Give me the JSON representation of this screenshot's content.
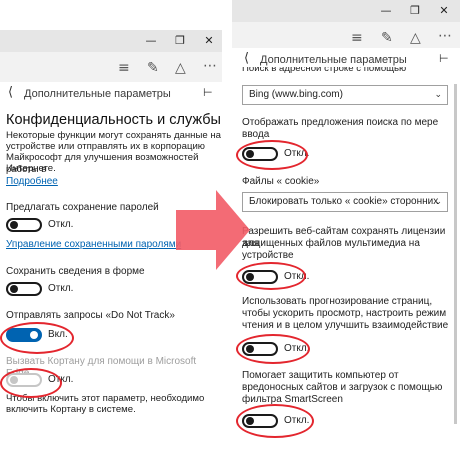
{
  "window": {
    "minimize_icon": "minimize-icon",
    "restore_icon": "restore-icon",
    "close_icon": "close-icon"
  },
  "toolbar_icons": [
    "hub-icon",
    "note-icon",
    "share-icon",
    "more-icon"
  ],
  "left": {
    "header_title": "Дополнительные параметры",
    "section_title": "Конфиденциальность и службы",
    "intro_lines": [
      "Некоторые функции могут сохранять данные на",
      "устройстве или отправлять их в корпорацию",
      "Майкрософт для улучшения возможностей работы в",
      "Интернете."
    ],
    "more_link": "Подробнее",
    "passwords_label": "Предлагать сохранение паролей",
    "passwords_state": "Откл.",
    "manage_passwords_link": "Управление сохраненными паролями",
    "forms_label": "Сохранить сведения в форме",
    "forms_state": "Откл.",
    "dnt_label": "Отправлять запросы «Do Not Track»",
    "dnt_state": "Вкл.",
    "cortana_label": "Вызвать Кортану для помощи в Microsoft Edge",
    "cortana_state": "Откл.",
    "cortana_note_lines": [
      "Чтобы включить этот параметр, необходимо",
      "включить Кортану в системе."
    ]
  },
  "right": {
    "header_title": "Дополнительные параметры",
    "cut_text": "Поиск в адресной строке с помощью",
    "search_engine_value": "Bing (www.bing.com)",
    "suggest_lines": [
      "Отображать предложения поиска по мере",
      "ввода"
    ],
    "suggest_state": "Откл.",
    "cookies_label": "Файлы « cookie»",
    "cookies_value": "Блокировать только « cookie» сторонних",
    "licenses_lines": [
      "Разрешить веб-сайтам сохранять лицензии для",
      "защищенных файлов мультимедиа на",
      "устройстве"
    ],
    "licenses_state": "Откл.",
    "predict_lines": [
      "Использовать прогнозирование страниц,",
      "чтобы ускорить просмотр, настроить режим",
      "чтения и в целом улучшить взаимодействие"
    ],
    "predict_state": "Откл.",
    "smartscreen_lines": [
      "Помогает защитить компьютер от",
      "вредоносных сайтов и загрузок с помощью",
      "фильтра SmartScreen"
    ],
    "smartscreen_state": "Откл."
  },
  "colors": {
    "accent": "#0063b1",
    "highlight_ring": "#e3262e",
    "arrow": "#f25b66"
  }
}
